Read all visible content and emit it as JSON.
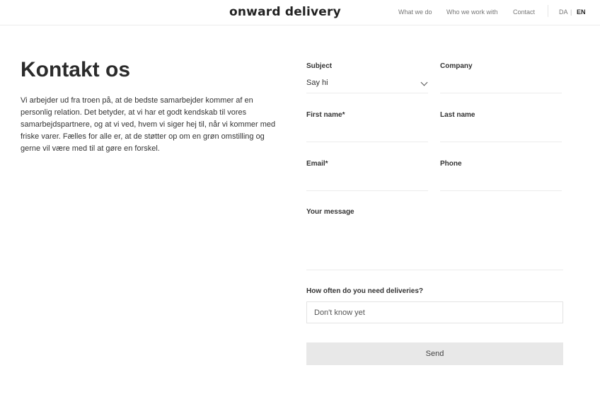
{
  "header": {
    "logo": "onward delivery",
    "nav": [
      "What we do",
      "Who we work with",
      "Contact"
    ],
    "lang": {
      "da": "DA",
      "sep": "|",
      "en": "EN"
    }
  },
  "intro": {
    "title": "Kontakt os",
    "text": "Vi arbejder ud fra troen på, at de bedste samarbejder kommer af en personlig relation. Det betyder, at vi har et godt kendskab til vores samarbejdspartnere, og at vi ved, hvem vi siger hej til, når vi kommer med friske varer. Fælles for alle er, at de støtter op om en grøn omstilling og gerne vil være med til at gøre en forskel."
  },
  "form": {
    "subject_label": "Subject",
    "subject_value": "Say hi",
    "company_label": "Company",
    "first_name_label": "First name*",
    "last_name_label": "Last name",
    "email_label": "Email*",
    "phone_label": "Phone",
    "message_label": "Your message",
    "frequency_label": "How often do you need deliveries?",
    "frequency_value": "Don't know yet",
    "send_label": "Send"
  }
}
